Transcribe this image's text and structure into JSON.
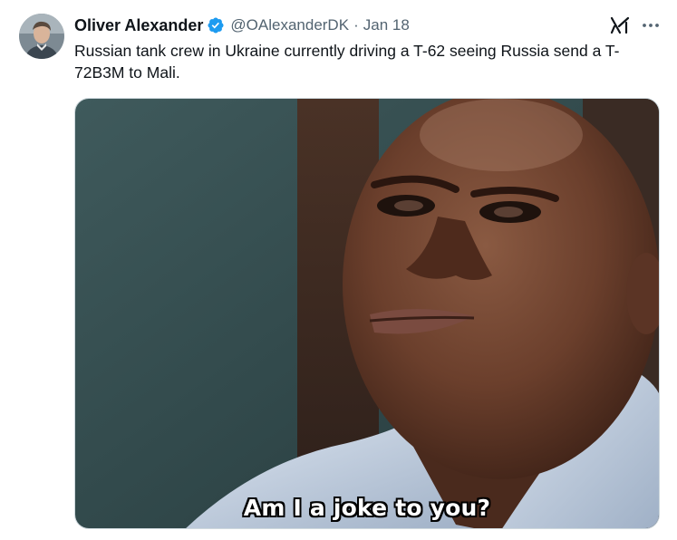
{
  "tweet": {
    "author": {
      "name": "Oliver Alexander",
      "handle": "@OAlexanderDK",
      "verified": true
    },
    "separator": "·",
    "date": "Jan 18",
    "text": "Russian tank crew in Ukraine currently driving a T-62 seeing Russia send a T-72B3M to Mali.",
    "media": {
      "caption": "Am I a joke to you?"
    }
  },
  "icons": {
    "avatar": "avatar-icon",
    "verified": "verified-badge-icon",
    "grok": "grok-icon",
    "more": "more-options-icon"
  },
  "colors": {
    "text_primary": "#0f1419",
    "text_secondary": "#536471",
    "verified_blue": "#1d9bf0",
    "media_border": "#cfd9de"
  }
}
